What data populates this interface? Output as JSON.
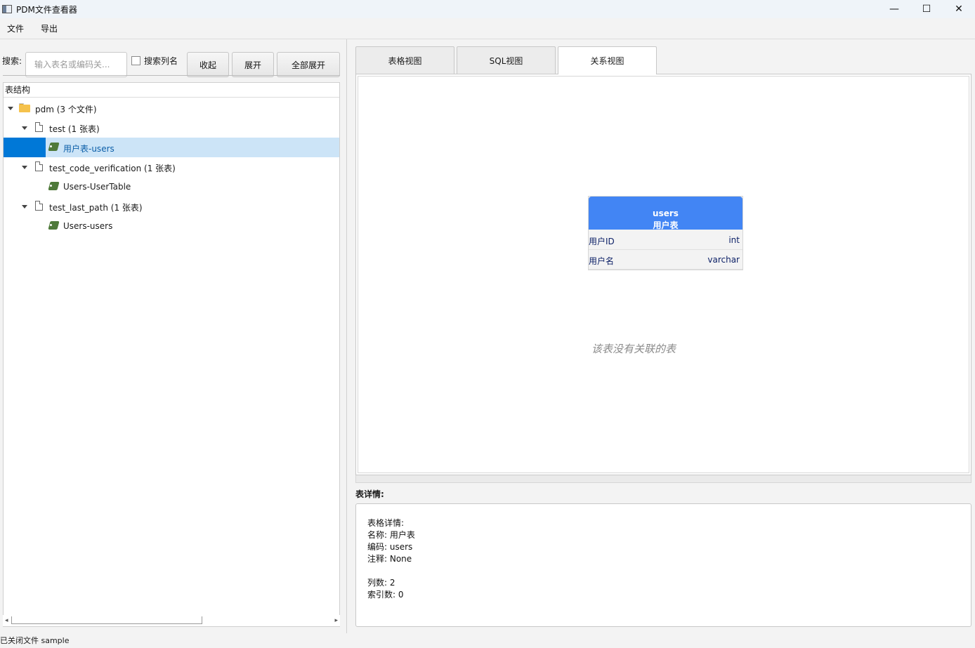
{
  "window": {
    "title": "PDM文件查看器",
    "controls": {
      "minimize": "—",
      "maximize": "☐",
      "close": "✕"
    }
  },
  "menu": {
    "file": "文件",
    "export": "导出"
  },
  "search": {
    "label": "搜索:",
    "placeholder": "输入表名或编码关...",
    "value": "",
    "search_columns_label": "搜索列名",
    "search_columns_checked": false
  },
  "buttons": {
    "collapse": "收起",
    "expand": "展开",
    "expand_all": "全部展开"
  },
  "tree": {
    "header": "表结构",
    "root": {
      "label": "pdm (3 个文件)"
    },
    "files": [
      {
        "label": "test (1 张表)",
        "tables": [
          {
            "label": "用户表-users",
            "selected": true
          }
        ]
      },
      {
        "label": "test_code_verification (1 张表)",
        "tables": [
          {
            "label": "Users-UserTable",
            "selected": false
          }
        ]
      },
      {
        "label": "test_last_path (1 张表)",
        "tables": [
          {
            "label": "Users-users",
            "selected": false
          }
        ]
      }
    ]
  },
  "tabs": [
    {
      "label": "表格视图",
      "active": false
    },
    {
      "label": "SQL视图",
      "active": false
    },
    {
      "label": "关系视图",
      "active": true
    }
  ],
  "relation_view": {
    "entity": {
      "code": "users",
      "name": "用户表",
      "columns": [
        {
          "name": "用户ID",
          "type": "int"
        },
        {
          "name": "用户名",
          "type": "varchar"
        }
      ]
    },
    "no_relation_text": "该表没有关联的表",
    "colors": {
      "entity_header": "#4285f4",
      "column_text": "#0b1f66"
    }
  },
  "details": {
    "title": "表详情:",
    "lines": [
      "表格详情:",
      "名称: 用户表",
      "编码: users",
      "注释: None",
      "",
      "列数: 2",
      "索引数: 0"
    ]
  },
  "status": "已关闭文件 sample",
  "colors": {
    "selection_bg": "#cce4f7",
    "selection_gutter": "#0078d7",
    "folder": "#f5c24c"
  }
}
